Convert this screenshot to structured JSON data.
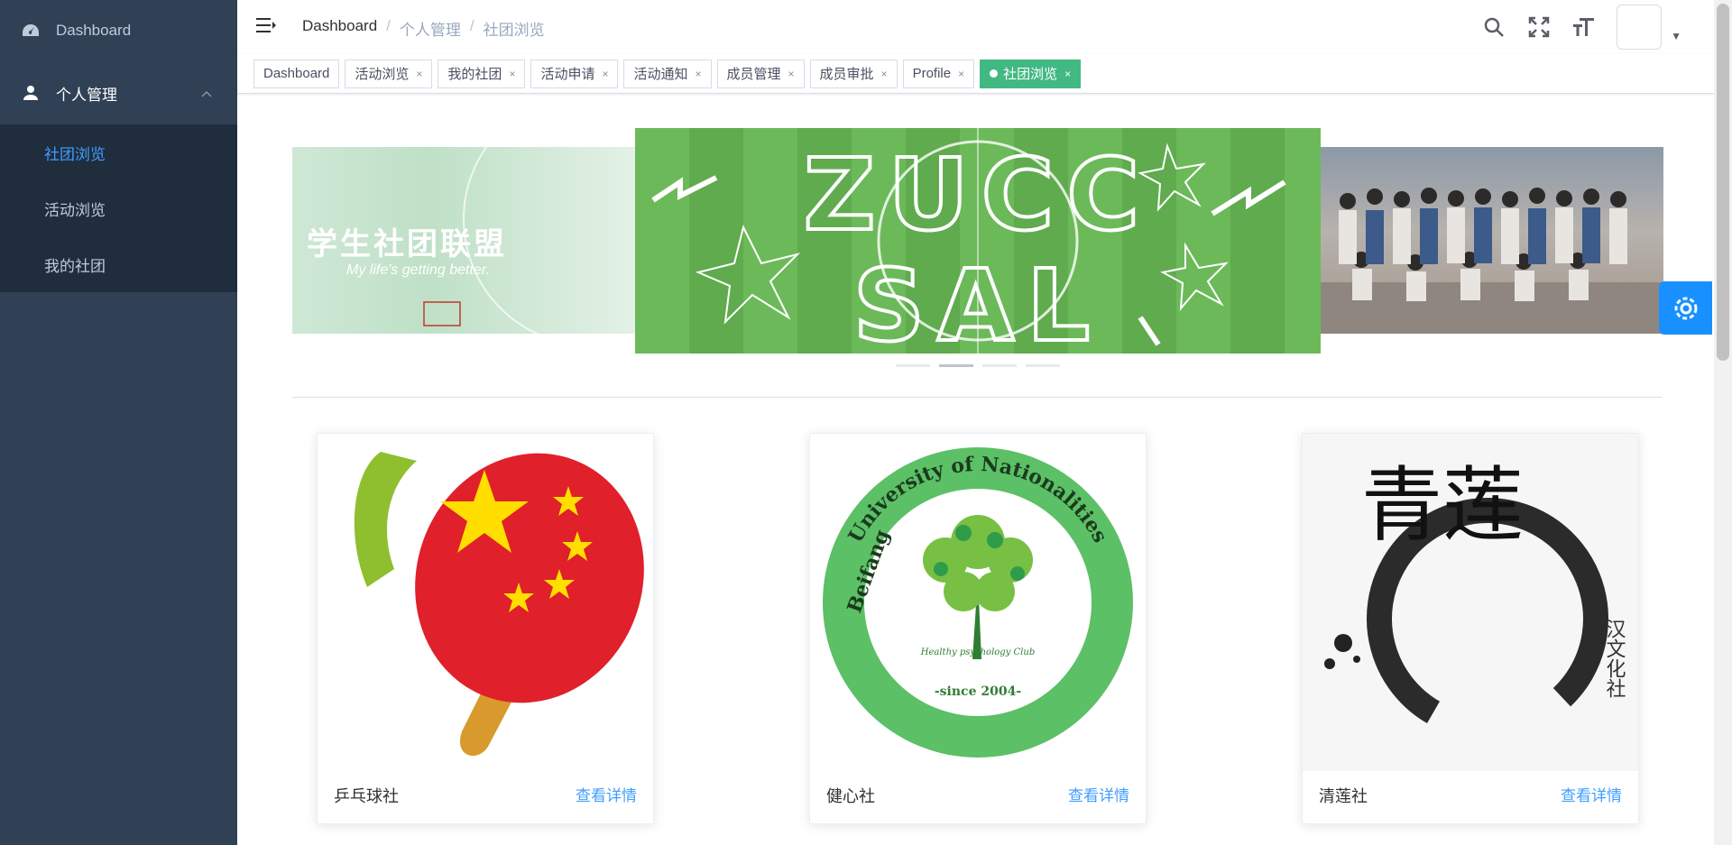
{
  "sidebar": {
    "dashboard_label": "Dashboard",
    "personal_label": "个人管理",
    "submenu": [
      {
        "label": "社团浏览",
        "active": true
      },
      {
        "label": "活动浏览",
        "active": false
      },
      {
        "label": "我的社团",
        "active": false
      }
    ],
    "bg_color": "#304156",
    "active_color": "#409eff"
  },
  "navbar": {
    "breadcrumb": [
      "Dashboard",
      "个人管理",
      "社团浏览"
    ],
    "separator": "/",
    "icons": [
      "search-icon",
      "fullscreen-icon",
      "font-size-icon"
    ]
  },
  "tags": [
    {
      "label": "Dashboard",
      "closable": false,
      "active": false
    },
    {
      "label": "活动浏览",
      "closable": true,
      "active": false
    },
    {
      "label": "我的社团",
      "closable": true,
      "active": false
    },
    {
      "label": "活动申请",
      "closable": true,
      "active": false
    },
    {
      "label": "活动通知",
      "closable": true,
      "active": false
    },
    {
      "label": "成员管理",
      "closable": true,
      "active": false
    },
    {
      "label": "成员审批",
      "closable": true,
      "active": false
    },
    {
      "label": "Profile",
      "closable": true,
      "active": false
    },
    {
      "label": "社团浏览",
      "closable": true,
      "active": true
    }
  ],
  "close_glyph": "×",
  "carousel": {
    "left_title": "学生社团联盟",
    "left_subtitle": "My life's getting better.",
    "center_text_1": "ZUCC",
    "center_text_2": "SAL",
    "indicator_count": 4,
    "active_index": 1
  },
  "clubs": [
    {
      "name": "乒乓球社",
      "link": "查看详情"
    },
    {
      "name": "健心社",
      "link": "查看详情",
      "logo_text_top": "University of Nationalities",
      "logo_text_left": "Beifang",
      "logo_since": "-since 2004-",
      "logo_inner": "Healthy psychology Club"
    },
    {
      "name": "清莲社",
      "link": "查看详情",
      "logo_big": "青莲",
      "logo_side": "汉文化社"
    }
  ],
  "accent": "#42b983"
}
